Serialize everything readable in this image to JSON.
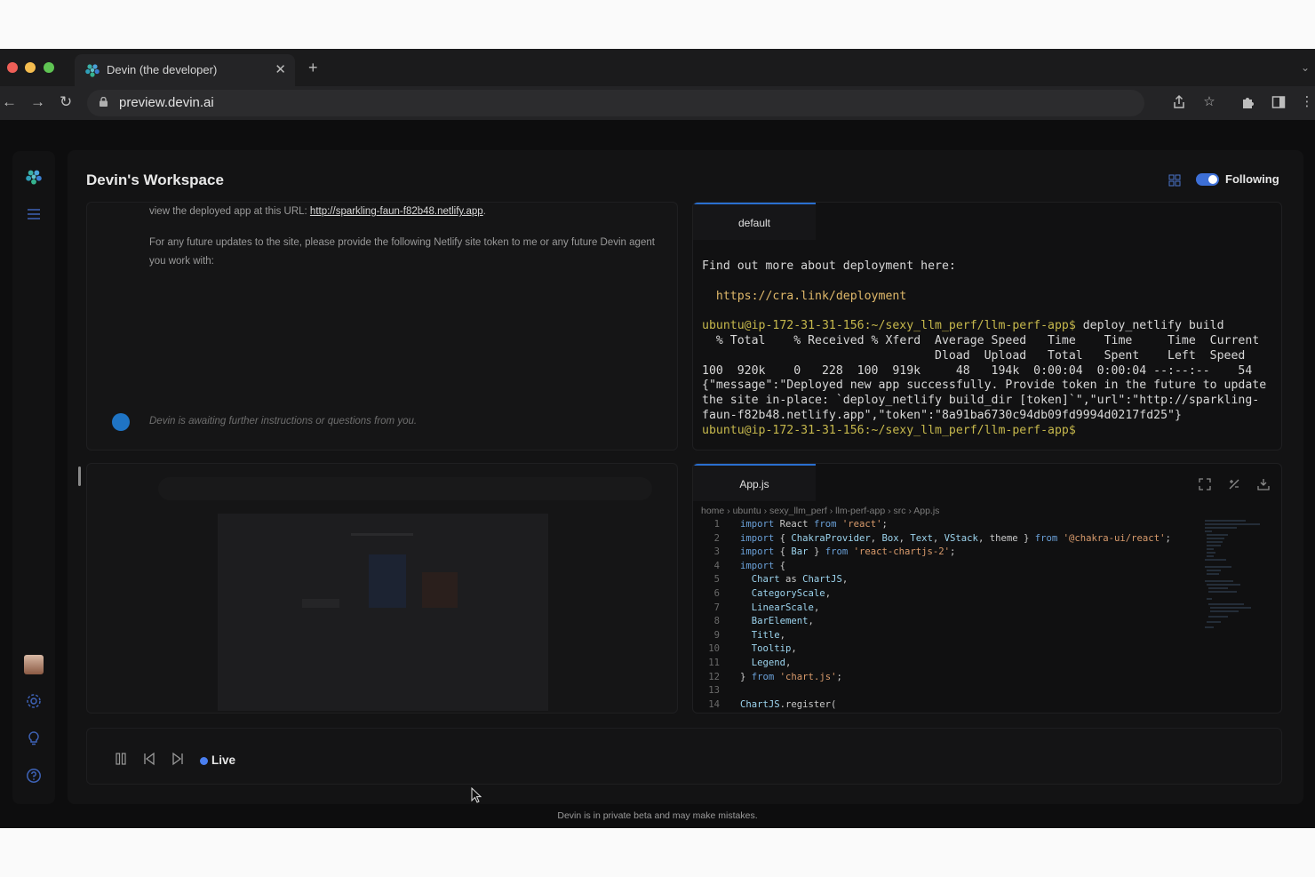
{
  "browser": {
    "tab_title": "Devin (the developer)",
    "url": "preview.devin.ai"
  },
  "workspace": {
    "title": "Devin's Workspace",
    "following_label": "Following"
  },
  "chat": {
    "line1_prefix": "view the deployed app at this URL: ",
    "line1_link": "http://sparkling-faun-f82b48.netlify.app",
    "line1_suffix": ".",
    "line2": "For any future updates to the site, please provide the following Netlify site token to me or any future Devin agent you work with:",
    "awaiting": "Devin is awaiting further instructions or questions from you."
  },
  "terminal": {
    "tab_label": "default",
    "line1": "Find out more about deployment here:",
    "link": "  https://cra.link/deployment",
    "prompt": "ubuntu@ip-172-31-31-156:~/sexy_llm_perf/llm-perf-app$",
    "command": " deploy_netlify build",
    "table": "  % Total    % Received % Xferd  Average Speed   Time    Time     Time  Current\n                                 Dload  Upload   Total   Spent    Left  Speed\n100  920k    0   228  100  919k     48   194k  0:00:04  0:00:04 --:--:--    54",
    "json": "{\"message\":\"Deployed new app successfully. Provide token in the future to update the site in-place: `deploy_netlify build_dir [token]`\",\"url\":\"http://sparkling-faun-f82b48.netlify.app\",\"token\":\"8a91ba6730c94db09fd9994d0217fd25\"}",
    "prompt2": "ubuntu@ip-172-31-31-156:~/sexy_llm_perf/llm-perf-app$"
  },
  "editor": {
    "tab_label": "App.js",
    "breadcrumb": "home › ubuntu › sexy_llm_perf › llm-perf-app › src › App.js",
    "lines": [
      {
        "n": "1",
        "html": "<span class=\"kw\">import</span> React <span class=\"kw\">from</span> <span class=\"st\">'react'</span>;"
      },
      {
        "n": "2",
        "html": "<span class=\"kw\">import</span> { <span class=\"vr\">ChakraProvider</span>, <span class=\"vr\">Box</span>, <span class=\"vr\">Text</span>, <span class=\"vr\">VStack</span>, theme } <span class=\"kw\">from</span> <span class=\"st\">'@chakra-ui/react'</span>;"
      },
      {
        "n": "3",
        "html": "<span class=\"kw\">import</span> { <span class=\"vr\">Bar</span> } <span class=\"kw\">from</span> <span class=\"st\">'react-chartjs-2'</span>;"
      },
      {
        "n": "4",
        "html": "<span class=\"kw\">import</span> {"
      },
      {
        "n": "5",
        "html": "  <span class=\"vr\">Chart</span> as <span class=\"vr\">ChartJS</span>,"
      },
      {
        "n": "6",
        "html": "  <span class=\"vr\">CategoryScale</span>,"
      },
      {
        "n": "7",
        "html": "  <span class=\"vr\">LinearScale</span>,"
      },
      {
        "n": "8",
        "html": "  <span class=\"vr\">BarElement</span>,"
      },
      {
        "n": "9",
        "html": "  <span class=\"vr\">Title</span>,"
      },
      {
        "n": "10",
        "html": "  <span class=\"vr\">Tooltip</span>,"
      },
      {
        "n": "11",
        "html": "  <span class=\"vr\">Legend</span>,"
      },
      {
        "n": "12",
        "html": "} <span class=\"kw\">from</span> <span class=\"st\">'chart.js'</span>;"
      },
      {
        "n": "13",
        "html": ""
      },
      {
        "n": "14",
        "html": "<span class=\"vr\">ChartJS</span>.register("
      }
    ]
  },
  "controls": {
    "live_label": "Live"
  },
  "footer": {
    "text": "Devin is in private beta and may make mistakes."
  },
  "colors": {
    "accent": "#3d6fd6",
    "tab_underline": "#2a6fd0",
    "terminal_prompt": "#c6b84c",
    "link": "#e0b96a"
  }
}
